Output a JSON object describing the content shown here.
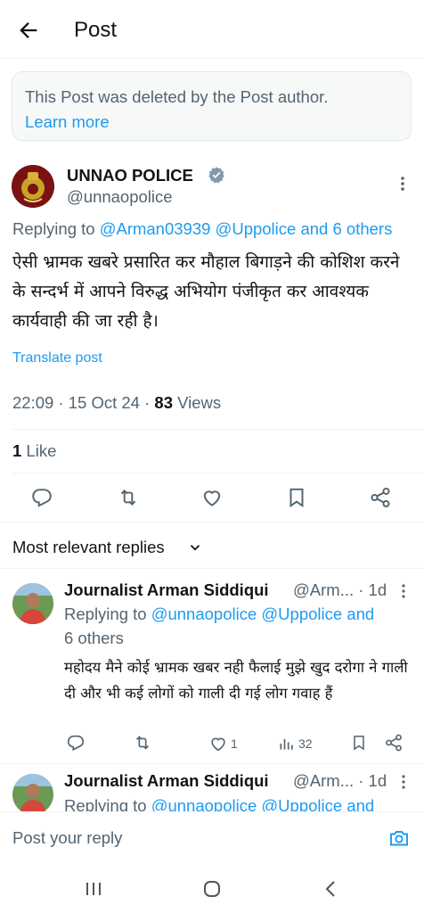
{
  "header": {
    "title": "Post",
    "back_icon": "arrow-left-icon"
  },
  "notice": {
    "text": "This Post was deleted by the Post author.",
    "link": "Learn more"
  },
  "post": {
    "author_name": "UNNAO POLICE",
    "handle": "@unnaopolice",
    "replying_prefix": "Replying to",
    "replying_users": "@Arman03939 @Uppolice and 6 others",
    "text": "ऐसी भ्रामक खबरे प्रसारित कर मौहाल बिगाड़ने की कोशिश करने के सन्दर्भ में आपने विरुद्ध अभियोग पंजीकृत कर आवश्यक कार्यवाही की जा रही है।",
    "translate": "Translate post",
    "time": "22:09 · 15 Oct 24 · ",
    "views_count": "83",
    "views_label": " Views",
    "likes_count": "1",
    "likes_label": " Like"
  },
  "replies_header": "Most relevant replies",
  "replies": [
    {
      "name": "Journalist Arman Siddiqui",
      "handle": "@Arm... · 1d",
      "replying_prefix": "Replying to",
      "replying_users_line1": "@unnaopolice @Uppolice and",
      "replying_users_line2": "6 others",
      "text": "महोदय मैने कोई भ्रामक खबर नही फैलाई मुझे खुद दरोगा ने गाली दी और भी कई लोगों को गाली दी गई लोग गवाह हैं",
      "likes": "1",
      "views": "32"
    },
    {
      "name": "Journalist Arman Siddiqui",
      "handle": "@Arm... · 1d",
      "replying_prefix": "Replying to",
      "replying_users_line1": "@unnaopolice @Uppolice and"
    }
  ],
  "composer": {
    "placeholder": "Post your reply"
  },
  "colors": {
    "accent": "#1d9bf0",
    "text": "#0f1419",
    "secondary": "#536471",
    "verified": "#829aab"
  }
}
